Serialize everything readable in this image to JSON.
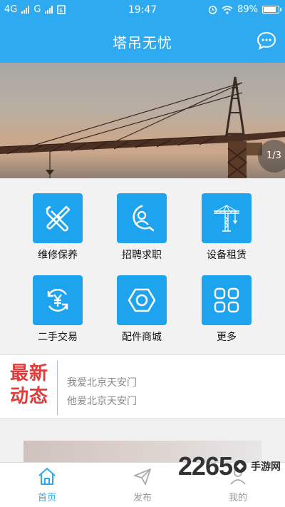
{
  "status_bar": {
    "left_network_1": "4G",
    "left_network_2": "G",
    "time": "19:47",
    "battery": "89%",
    "battery_level": 0.89
  },
  "header": {
    "title": "塔吊无忧",
    "message_icon": "chat-bubble-icon"
  },
  "banner": {
    "pager": "1/3"
  },
  "grid": {
    "items": [
      {
        "label": "维修保养",
        "icon": "tools-icon"
      },
      {
        "label": "招聘求职",
        "icon": "person-search-icon"
      },
      {
        "label": "设备租赁",
        "icon": "tower-crane-icon"
      },
      {
        "label": "二手交易",
        "icon": "yen-exchange-icon"
      },
      {
        "label": "配件商城",
        "icon": "hex-nut-icon"
      },
      {
        "label": "更多",
        "icon": "apps-grid-icon"
      }
    ]
  },
  "news": {
    "badge_line1": "最新",
    "badge_line2": "动态",
    "items": [
      "我爱北京天安门",
      "他爱北京天安门"
    ]
  },
  "tabbar": {
    "tabs": [
      {
        "label": "首页",
        "icon": "home-icon",
        "active": true
      },
      {
        "label": "发布",
        "icon": "paper-plane-icon",
        "active": false
      },
      {
        "label": "我的",
        "icon": "user-icon",
        "active": false
      }
    ]
  },
  "watermark": {
    "number": "2265",
    "text": "手游网"
  },
  "colors": {
    "primary": "#2eaaf0",
    "tile": "#1ea4ee",
    "news_badge": "#e03c3c"
  }
}
